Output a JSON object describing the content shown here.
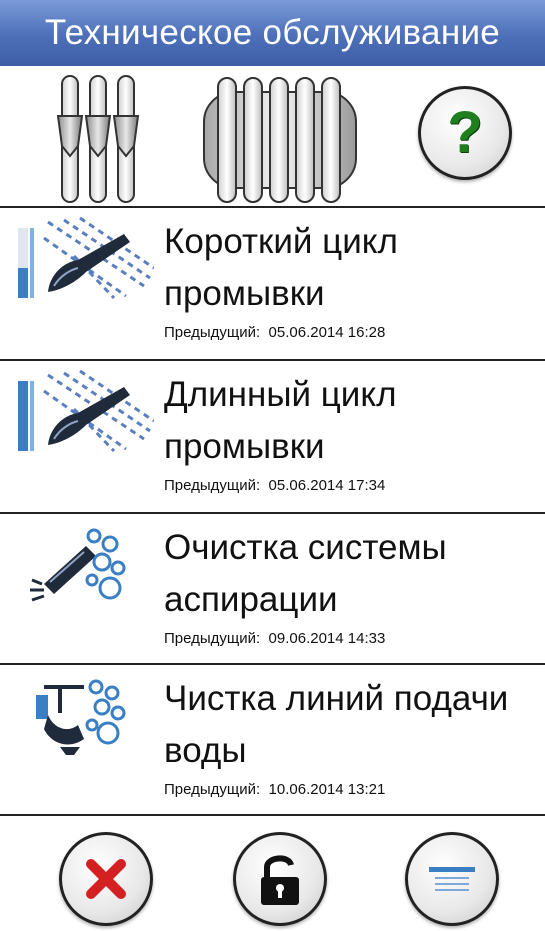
{
  "header": {
    "title": "Техническое обслуживание"
  },
  "toolbar": {
    "items": [
      {
        "icon": "triple-slider-icon"
      },
      {
        "icon": "instrument-rack-icon"
      },
      {
        "icon": "help-icon",
        "symbol": "?"
      }
    ]
  },
  "maintenance": {
    "items": [
      {
        "icon": "short-flush-icon",
        "title_line1": "Короткий цикл",
        "title_line2": "промывки",
        "prev_label": "Предыдущий:",
        "prev_value": "05.06.2014 16:28"
      },
      {
        "icon": "long-flush-icon",
        "title_line1": "Длинный цикл",
        "title_line2": "промывки",
        "prev_label": "Предыдущий:",
        "prev_value": "05.06.2014 17:34"
      },
      {
        "icon": "suction-cleaning-icon",
        "title_line1": "Очистка системы",
        "title_line2": "аспирации",
        "prev_label": "Предыдущий:",
        "prev_value": "09.06.2014 14:33"
      },
      {
        "icon": "waterline-cleaning-icon",
        "title_line1": "Чистка линий подачи",
        "title_line2": "воды",
        "prev_label": "Предыдущий:",
        "prev_value": "10.06.2014 13:21"
      }
    ]
  },
  "footer": {
    "buttons": [
      {
        "icon": "close-icon"
      },
      {
        "icon": "unlock-icon"
      },
      {
        "icon": "menu-icon"
      }
    ]
  },
  "colors": {
    "header": "#4d6fb8",
    "accent_blue": "#3a7fc4",
    "help_green": "#1f7f1f",
    "close_red": "#d42020"
  }
}
